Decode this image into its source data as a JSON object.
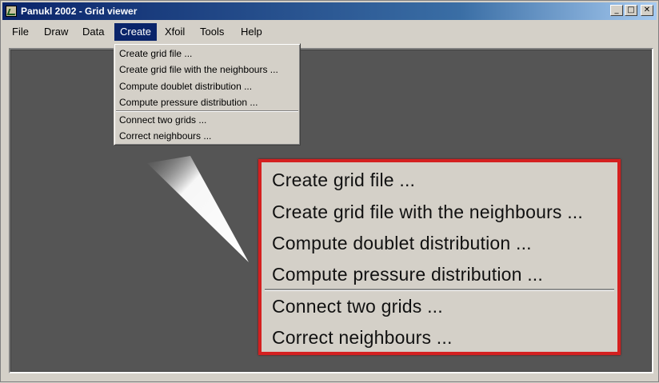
{
  "window": {
    "title": "Panukl 2002 - Grid viewer",
    "controls": {
      "minimize": "_",
      "maximize": "□",
      "close": "✕"
    }
  },
  "menubar": {
    "items": [
      "File",
      "Draw",
      "Data",
      "Create",
      "Xfoil",
      "Tools",
      "Help"
    ],
    "active": "Create"
  },
  "create_menu": {
    "items": [
      "Create grid file ...",
      "Create grid file with the neighbours ...",
      "Compute doublet distribution ...",
      "Compute pressure distribution ...",
      "Connect two grids ...",
      "Correct neighbours ..."
    ]
  },
  "colors": {
    "titlebar_start": "#0a246a",
    "canvas": "#555555",
    "callout_border": "#d42020",
    "menu_bg": "#d4d0c8"
  },
  "icons": {
    "app": "app-icon",
    "minimize": "minimize-icon",
    "maximize": "maximize-icon",
    "close": "close-icon"
  }
}
